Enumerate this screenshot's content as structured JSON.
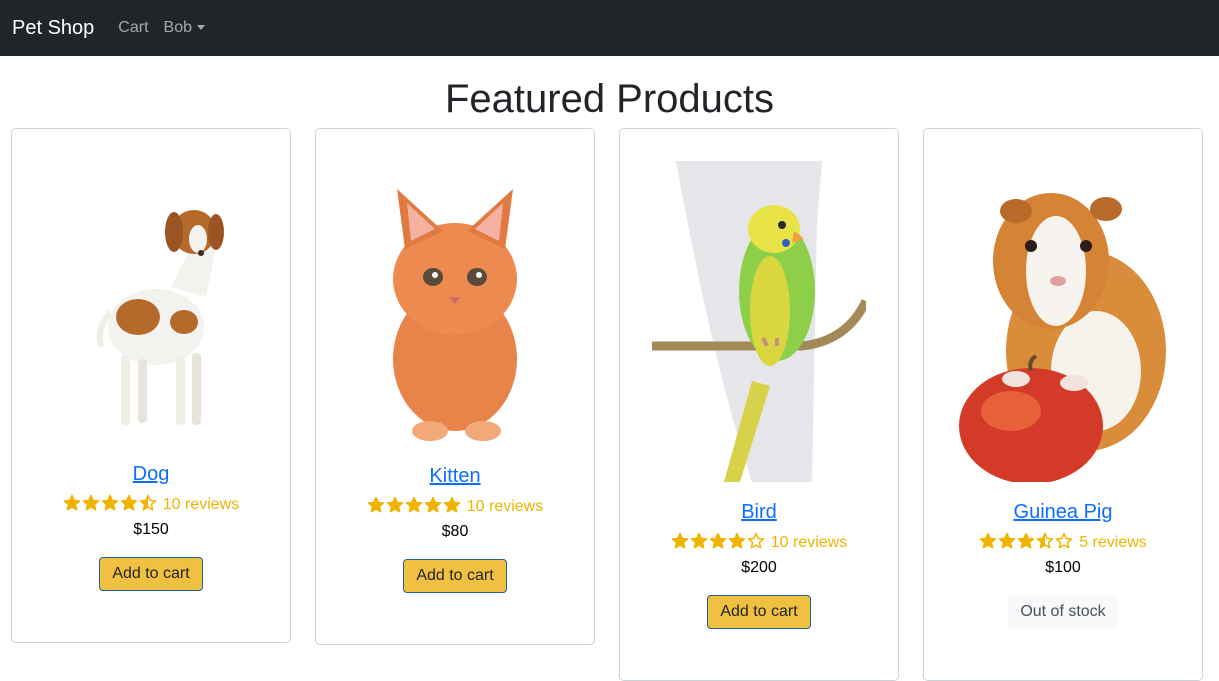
{
  "navbar": {
    "brand": "Pet Shop",
    "links": [
      {
        "label": "Cart"
      },
      {
        "label": "Bob"
      }
    ]
  },
  "page": {
    "title": "Featured Products"
  },
  "colors": {
    "star": "#f0b400",
    "link": "#0d6efd",
    "button": "#f0c040",
    "navbar": "#212529"
  },
  "products": [
    {
      "name": "Dog",
      "rating": 4.5,
      "reviews": "10 reviews",
      "price": "$150",
      "action": "Add to cart",
      "in_stock": true,
      "image": "dog-photo"
    },
    {
      "name": "Kitten",
      "rating": 5,
      "reviews": "10 reviews",
      "price": "$80",
      "action": "Add to cart",
      "in_stock": true,
      "image": "kitten-photo"
    },
    {
      "name": "Bird",
      "rating": 4,
      "reviews": "10 reviews",
      "price": "$200",
      "action": "Add to cart",
      "in_stock": true,
      "image": "budgie-photo"
    },
    {
      "name": "Guinea Pig",
      "rating": 3.5,
      "reviews": "5 reviews",
      "price": "$100",
      "action": "Out of stock",
      "in_stock": false,
      "image": "guinea-pig-photo"
    }
  ]
}
